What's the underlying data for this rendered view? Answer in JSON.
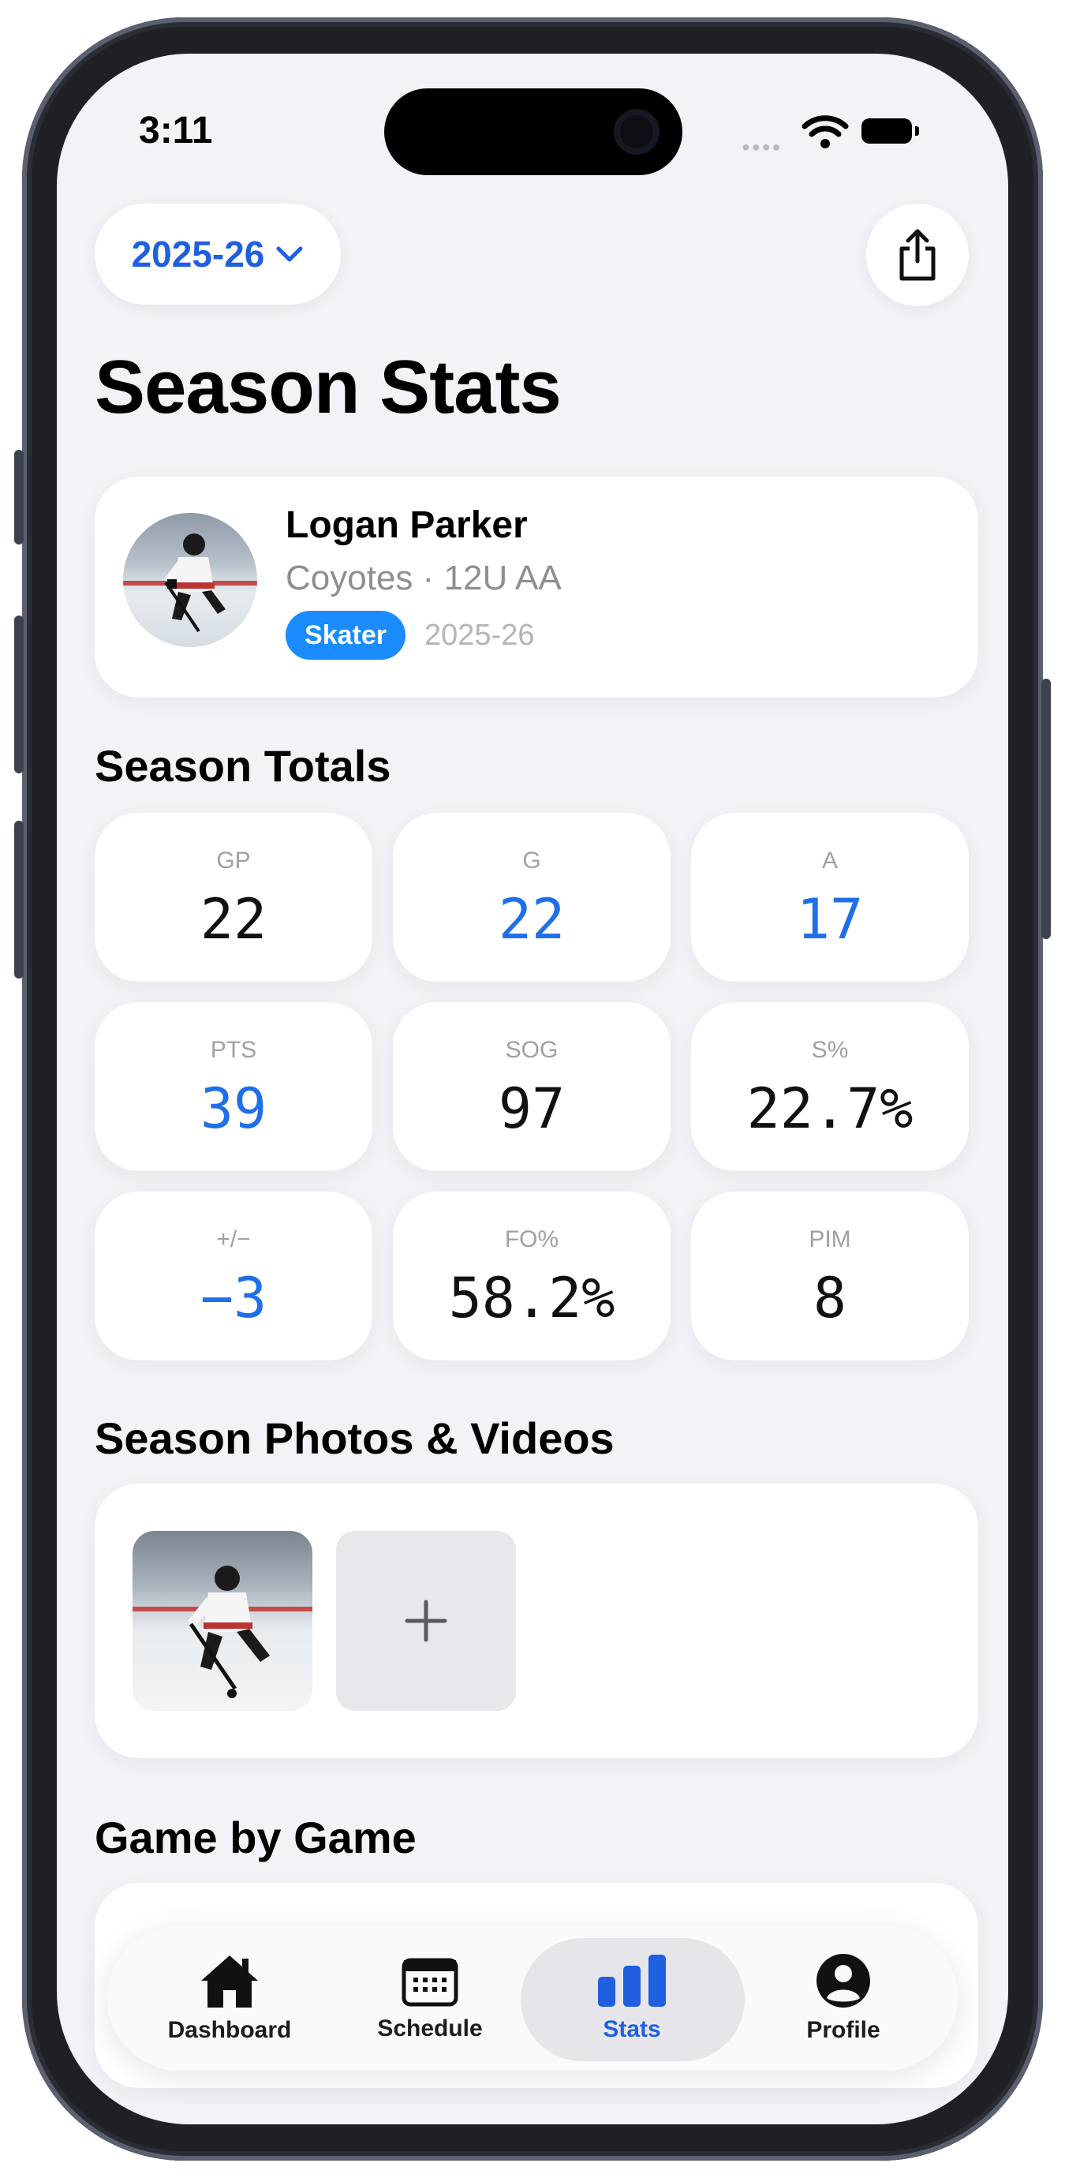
{
  "status_bar": {
    "time": "3:11"
  },
  "header": {
    "season_selector": "2025-26",
    "title": "Season Stats"
  },
  "player": {
    "name": "Logan Parker",
    "team": "Coyotes · 12U AA",
    "position_badge": "Skater",
    "season": "2025-26"
  },
  "totals": {
    "heading": "Season Totals",
    "stats": [
      {
        "label": "GP",
        "value": "22"
      },
      {
        "label": "G",
        "value": "22"
      },
      {
        "label": "A",
        "value": "17"
      },
      {
        "label": "PTS",
        "value": "39"
      },
      {
        "label": "SOG",
        "value": "97"
      },
      {
        "label": "S%",
        "value": "22.7%"
      },
      {
        "label": "+/−",
        "value": "−3"
      },
      {
        "label": "FO%",
        "value": "58.2%"
      },
      {
        "label": "PIM",
        "value": "8"
      }
    ]
  },
  "media": {
    "heading": "Season Photos & Videos"
  },
  "games": {
    "heading": "Game by Game"
  },
  "tabbar": {
    "items": [
      {
        "label": "Dashboard",
        "icon": "house-icon"
      },
      {
        "label": "Schedule",
        "icon": "calendar-icon"
      },
      {
        "label": "Stats",
        "icon": "bar-chart-icon",
        "active": true
      },
      {
        "label": "Profile",
        "icon": "person-icon"
      }
    ]
  },
  "colors": {
    "accent": "#1f6fe8",
    "badge": "#1a8cff",
    "background": "#f2f2f7"
  }
}
